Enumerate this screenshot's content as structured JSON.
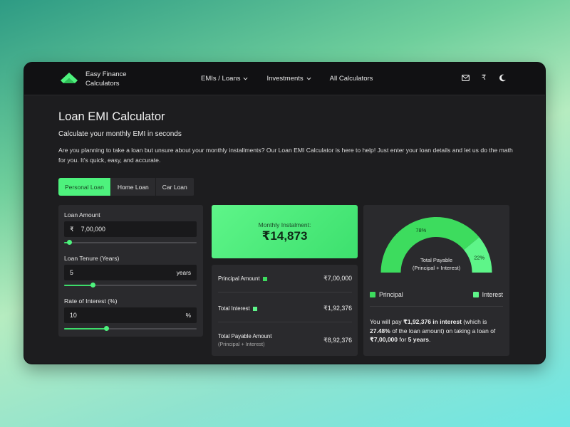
{
  "brand": {
    "line1": "Easy Finance",
    "line2": "Calculators",
    "color": "#4ef27d"
  },
  "nav": [
    {
      "label": "EMIs / Loans",
      "has_dropdown": true
    },
    {
      "label": "Investments",
      "has_dropdown": true
    },
    {
      "label": "All Calculators",
      "has_dropdown": false
    }
  ],
  "top_icons": [
    "mail-icon",
    "rupee-icon",
    "moon-icon"
  ],
  "top_icon_glyph_rupee": "₹",
  "page": {
    "title": "Loan EMI Calculator",
    "subtitle": "Calculate your monthly EMI in seconds",
    "description": "Are you planning to take a loan but unsure about your monthly installments? Our Loan EMI Calculator is here to help! Just enter your loan details and let us do the math for you. It's quick, easy, and accurate."
  },
  "tabs": [
    {
      "label": "Personal Loan",
      "active": true
    },
    {
      "label": "Home Loan",
      "active": false
    },
    {
      "label": "Car Loan",
      "active": false
    }
  ],
  "inputs": {
    "loan_amount": {
      "label": "Loan Amount",
      "prefix": "₹",
      "value": "7,00,000",
      "slider_fraction": 0.04
    },
    "tenure": {
      "label": "Loan Tenure (Years)",
      "value": "5",
      "suffix": "years",
      "slider_fraction": 0.22
    },
    "interest": {
      "label": "Rate of Interest (%)",
      "value": "10",
      "suffix": "%",
      "slider_fraction": 0.32
    }
  },
  "monthly": {
    "label": "Monthly Instalment:",
    "value": "₹14,873"
  },
  "summary": {
    "principal": {
      "label": "Principal Amount",
      "value": "₹7,00,000"
    },
    "interest": {
      "label": "Total Interest",
      "value": "₹1,92,376"
    },
    "total": {
      "label": "Total Payable Amount",
      "sub": "(Principal + Interest)",
      "value": "₹8,92,376"
    }
  },
  "chart_data": {
    "type": "pie",
    "style": "half-donut",
    "center_label_line1": "Total Payable",
    "center_label_line2": "(Principal + Interest)",
    "slices": [
      {
        "name": "Principal",
        "percent": 78,
        "label": "78%",
        "color": "#3ddc5e"
      },
      {
        "name": "Interest",
        "percent": 22,
        "label": "22%",
        "color": "#5ef589"
      }
    ]
  },
  "legend": {
    "principal": "Principal",
    "interest": "Interest"
  },
  "note": {
    "p1": "You will pay ",
    "b1": "₹1,92,376 in interest",
    "p2": " (which is ",
    "b2": "27.48%",
    "p3": " of the loan amount) on taking a loan of ",
    "b3": "₹7,00,000",
    "p4": " for ",
    "b4": "5 years",
    "p5": "."
  },
  "colors": {
    "accent": "#4ef27d",
    "principal": "#3ddc5e",
    "interest": "#5ef589",
    "card": "#2a2a2d",
    "bg": "#1d1d1f"
  }
}
